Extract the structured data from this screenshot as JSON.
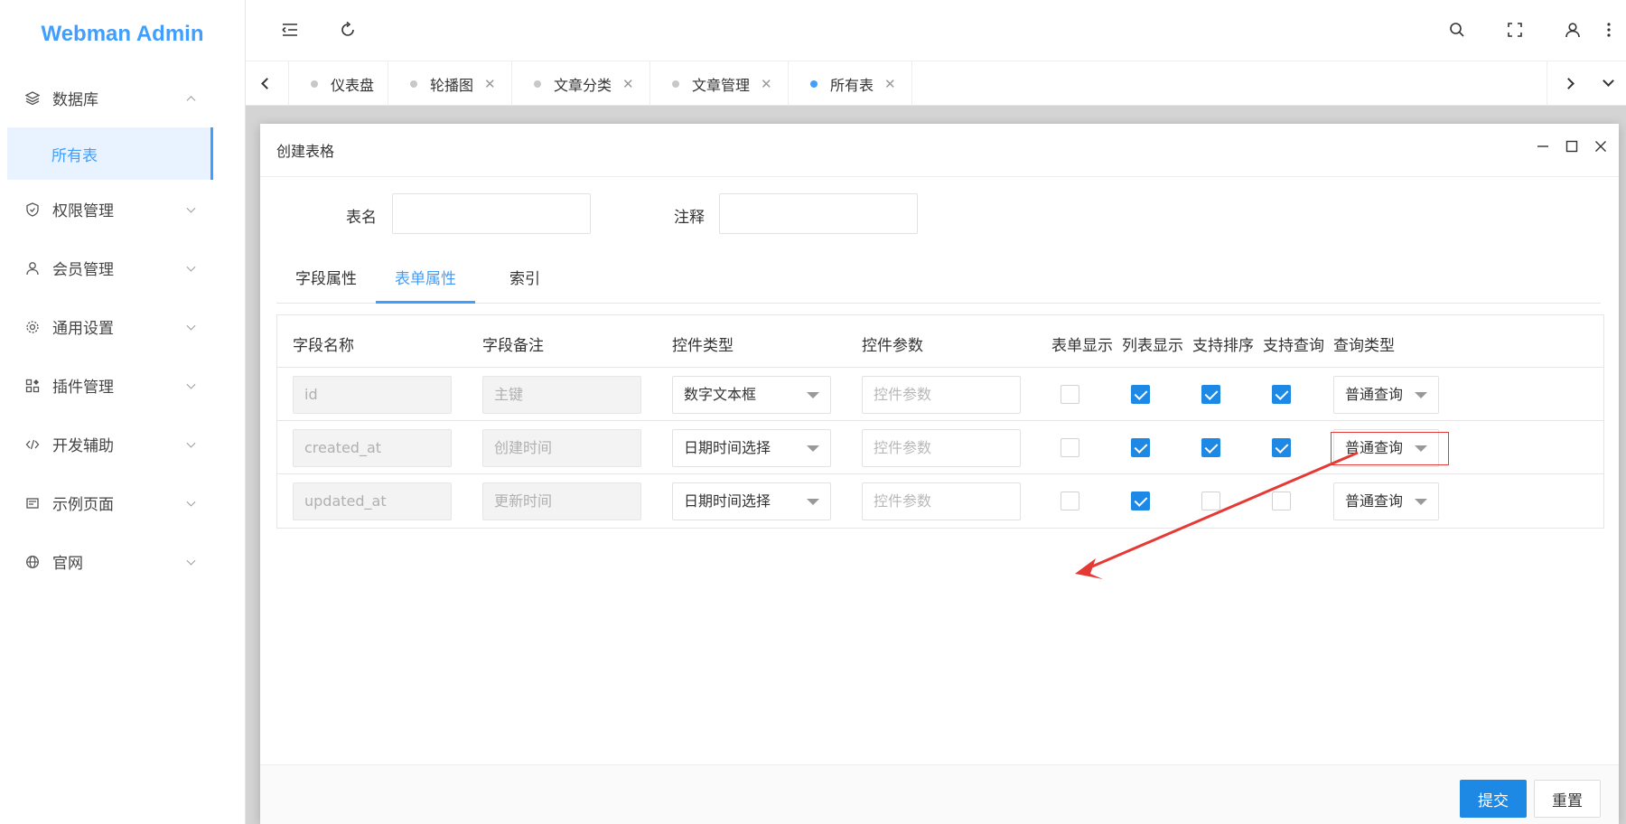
{
  "app": {
    "title": "Webman Admin"
  },
  "sidebar": {
    "items": [
      {
        "label": "数据库",
        "icon": "database-icon",
        "expanded": true
      },
      {
        "label": "权限管理",
        "icon": "shield-icon"
      },
      {
        "label": "会员管理",
        "icon": "user-icon"
      },
      {
        "label": "通用设置",
        "icon": "gear-icon"
      },
      {
        "label": "插件管理",
        "icon": "plugin-icon"
      },
      {
        "label": "开发辅助",
        "icon": "code-icon"
      },
      {
        "label": "示例页面",
        "icon": "page-icon"
      },
      {
        "label": "官网",
        "icon": "globe-icon"
      }
    ],
    "active_sub": "所有表"
  },
  "tabs": [
    {
      "label": "仪表盘",
      "closable": false
    },
    {
      "label": "轮播图",
      "closable": true
    },
    {
      "label": "文章分类",
      "closable": true
    },
    {
      "label": "文章管理",
      "closable": true
    },
    {
      "label": "所有表",
      "closable": true,
      "active": true
    }
  ],
  "modal": {
    "title": "创建表格",
    "form": {
      "table_name_label": "表名",
      "comment_label": "注释",
      "table_name_value": "",
      "comment_value": ""
    },
    "sub_tabs": [
      "字段属性",
      "表单属性",
      "索引"
    ],
    "active_sub_tab": "表单属性",
    "columns": [
      "字段名称",
      "字段备注",
      "控件类型",
      "控件参数",
      "表单显示",
      "列表显示",
      "支持排序",
      "支持查询",
      "查询类型"
    ],
    "rows": [
      {
        "field": "id",
        "remark": "主键",
        "control": "数字文本框",
        "param_placeholder": "控件参数",
        "form_show": false,
        "list_show": true,
        "sortable": true,
        "searchable": true,
        "query_type": "普通查询"
      },
      {
        "field": "created_at",
        "remark": "创建时间",
        "control": "日期时间选择",
        "param_placeholder": "控件参数",
        "form_show": false,
        "list_show": true,
        "sortable": true,
        "searchable": true,
        "query_type": "普通查询"
      },
      {
        "field": "updated_at",
        "remark": "更新时间",
        "control": "日期时间选择",
        "param_placeholder": "控件参数",
        "form_show": false,
        "list_show": true,
        "sortable": false,
        "searchable": false,
        "query_type": "普通查询"
      }
    ],
    "submit_label": "提交",
    "reset_label": "重置"
  },
  "colors": {
    "accent": "#409eff",
    "checkbox": "#1e88e5",
    "annotation": "#e53935"
  }
}
